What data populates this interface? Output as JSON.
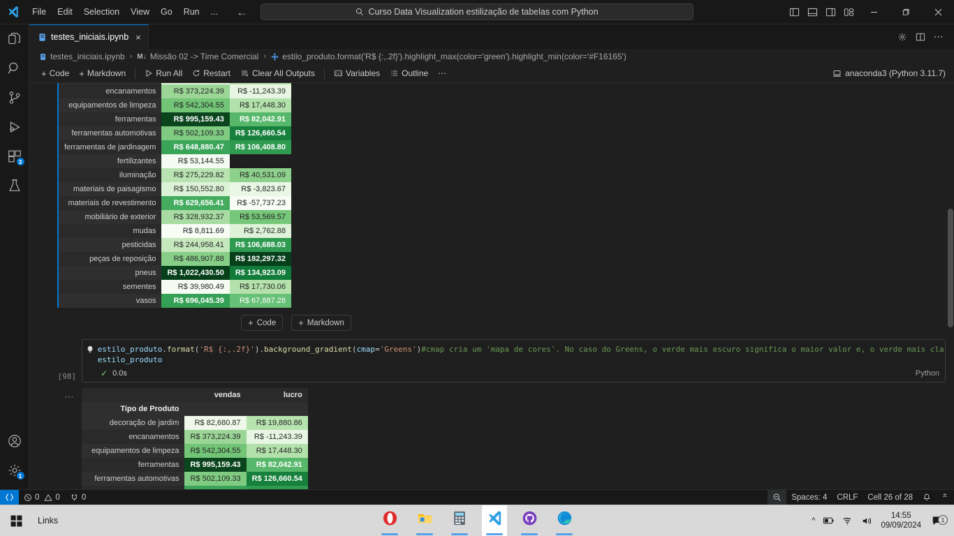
{
  "titlebar": {
    "menu": [
      "File",
      "Edit",
      "Selection",
      "View",
      "Go",
      "Run",
      "..."
    ],
    "search_text": "Curso Data Visualization estilização de tabelas com Python",
    "back_icon": "arrow-left-icon",
    "forward_icon": "arrow-right-icon"
  },
  "activitybar": {
    "items": [
      {
        "name": "explorer",
        "icon": "files-icon",
        "badge": ""
      },
      {
        "name": "search",
        "icon": "search-icon",
        "badge": ""
      },
      {
        "name": "source-control",
        "icon": "source-control-icon",
        "badge": ""
      },
      {
        "name": "run-and-debug",
        "icon": "run-debug-icon",
        "badge": ""
      },
      {
        "name": "extensions",
        "icon": "extensions-icon",
        "badge": "3"
      },
      {
        "name": "testing",
        "icon": "beaker-icon",
        "badge": ""
      }
    ],
    "bottom": [
      {
        "name": "accounts",
        "icon": "account-icon",
        "badge": ""
      },
      {
        "name": "manage",
        "icon": "gear-icon",
        "badge": "1"
      }
    ]
  },
  "tab": {
    "label": "testes_iniciais.ipynb",
    "close": "×"
  },
  "breadcrumbs": {
    "file": "testes_iniciais.ipynb",
    "section": "Missão 02 -> Time Comercial",
    "cell": "estilo_produto.format('R$ {:,.2f}').highlight_max(color='green').highlight_min(color='#F16165')",
    "md_badge": "M↓"
  },
  "notebook_toolbar": {
    "code": "Code",
    "markdown": "Markdown",
    "run_all": "Run All",
    "restart": "Restart",
    "clear_all_outputs": "Clear All Outputs",
    "variables": "Variables",
    "outline": "Outline",
    "more": "⋯",
    "kernel": "anaconda3 (Python 3.11.7)"
  },
  "add_cell": {
    "code": "Code",
    "markdown": "Markdown"
  },
  "code_cell": {
    "execution_count": "[98]",
    "duration": "0.0s",
    "language": "Python",
    "line1": {
      "var": "estilo_produto",
      "dot1": ".",
      "fn1": "format",
      "open1": "(",
      "str1": "'R$ {:,.2f}'",
      "close1": ")",
      "dot2": ".",
      "fn2": "background_gradient",
      "open2": "(",
      "param": "cmap",
      "eq": "=",
      "str2": "'Greens'",
      "close2": ")",
      "comment": "#cmap cria um 'mapa de cores'. No caso do Greens, o verde mais escuro significa o maior valor e, o verde mais claro (branco), significa o menor valor"
    },
    "line2": "estilo_produto"
  },
  "tables": {
    "columns": [
      "vendas",
      "lucro"
    ],
    "index_name": "Tipo de Produto",
    "rows": [
      {
        "label": "decoração de jardim",
        "vendas": "R$ 82,680.87",
        "lucro": "R$ 19,880.86",
        "vendas_bg": "#eff8ea",
        "lucro_bg": "#b7e3ae",
        "vendas_fg": "#262626",
        "lucro_fg": "#262626",
        "vendas_bold": false,
        "lucro_bold": false
      },
      {
        "label": "encanamentos",
        "vendas": "R$ 373,224.39",
        "lucro": "R$ -11,243.39",
        "vendas_bg": "#9bd696",
        "lucro_bg": "#e7f6e2",
        "vendas_fg": "#262626",
        "lucro_fg": "#262626",
        "vendas_bold": false,
        "lucro_bold": false
      },
      {
        "label": "equipamentos de limpeza",
        "vendas": "R$ 542,304.55",
        "lucro": "R$ 17,448.30",
        "vendas_bg": "#72c476",
        "lucro_bg": "#b3e1ab",
        "vendas_fg": "#262626",
        "lucro_fg": "#262626",
        "vendas_bold": false,
        "lucro_bold": false
      },
      {
        "label": "ferramentas",
        "vendas": "R$ 995,159.43",
        "lucro": "R$ 82,042.91",
        "vendas_bg": "#0a451d",
        "lucro_bg": "#57b76b",
        "vendas_fg": "#ffffff",
        "lucro_fg": "#ffffff",
        "vendas_bold": true,
        "lucro_bold": true
      },
      {
        "label": "ferramentas automotivas",
        "vendas": "R$ 502,109.33",
        "lucro": "R$ 126,660.54",
        "vendas_bg": "#7fcb81",
        "lucro_bg": "#16803c",
        "vendas_fg": "#262626",
        "lucro_fg": "#ffffff",
        "vendas_bold": false,
        "lucro_bold": true
      },
      {
        "label": "ferramentas de jardinagem",
        "vendas": "R$ 648,880.47",
        "lucro": "R$ 106,408.80",
        "vendas_bg": "#3aa458",
        "lucro_bg": "#2e9b51",
        "vendas_fg": "#ffffff",
        "lucro_fg": "#ffffff",
        "vendas_bold": true,
        "lucro_bold": true
      },
      {
        "label": "fertilizantes",
        "vendas": "R$ 53,144.55",
        "lucro": "R$ 22,509.86",
        "vendas_bg": "#f4fbf2",
        "lucro_bg": "#aede a6",
        "vendas_fg": "#262626",
        "lucro_fg": "#262626",
        "vendas_bold": false,
        "lucro_bold": false
      },
      {
        "label": "iluminação",
        "vendas": "R$ 275,229.82",
        "lucro": "R$ 40,531.09",
        "vendas_bg": "#b9e4b2",
        "lucro_bg": "#8ed18c",
        "vendas_fg": "#262626",
        "lucro_fg": "#262626",
        "vendas_bold": false,
        "lucro_bold": false
      },
      {
        "label": "materiais de paisagismo",
        "vendas": "R$ 150,552.80",
        "lucro": "R$ -3,823.67",
        "vendas_bg": "#dcf2d6",
        "lucro_bg": "#e9f7e4",
        "vendas_fg": "#262626",
        "lucro_fg": "#262626",
        "vendas_bold": false,
        "lucro_bold": false
      },
      {
        "label": "materiais de revestimento",
        "vendas": "R$ 629,656.41",
        "lucro": "R$ -57,737.23",
        "vendas_bg": "#44ab5f",
        "lucro_bg": "#f7fcf5",
        "vendas_fg": "#ffffff",
        "lucro_fg": "#262626",
        "vendas_bold": true,
        "lucro_bold": false
      },
      {
        "label": "mobiliário de exterior",
        "vendas": "R$ 328,932.37",
        "lucro": "R$ 53,569.57",
        "vendas_bg": "#a8dca2",
        "lucro_bg": "#76c77a",
        "vendas_fg": "#262626",
        "lucro_fg": "#262626",
        "vendas_bold": false,
        "lucro_bold": false
      },
      {
        "label": "mudas",
        "vendas": "R$ 8,811.69",
        "lucro": "R$ 2,762.88",
        "vendas_bg": "#f7fcf5",
        "lucro_bg": "#ddf2d7",
        "vendas_fg": "#262626",
        "lucro_fg": "#262626",
        "vendas_bold": false,
        "lucro_bold": false
      },
      {
        "label": "pesticidas",
        "vendas": "R$ 244,958.41",
        "lucro": "R$ 106,688.03",
        "vendas_bg": "#c5e8bd",
        "lucro_bg": "#2e9b51",
        "vendas_fg": "#262626",
        "lucro_fg": "#ffffff",
        "vendas_bold": false,
        "lucro_bold": true
      },
      {
        "label": "peças de reposição",
        "vendas": "R$ 486,907.88",
        "lucro": "R$ 182,297.32",
        "vendas_bg": "#87cf88",
        "lucro_bg": "#06401a",
        "vendas_fg": "#262626",
        "lucro_fg": "#ffffff",
        "vendas_bold": false,
        "lucro_bold": true
      },
      {
        "label": "pneus",
        "vendas": "R$ 1,022,430.50",
        "lucro": "R$ 134,923.09",
        "vendas_bg": "#06401a",
        "lucro_bg": "#117b39",
        "vendas_fg": "#ffffff",
        "lucro_fg": "#ffffff",
        "vendas_bold": true,
        "lucro_bold": true
      },
      {
        "label": "sementes",
        "vendas": "R$ 39,980.49",
        "lucro": "R$ 17,730.06",
        "vendas_bg": "#f6fcf4",
        "lucro_bg": "#b4e1ac",
        "vendas_fg": "#262626",
        "lucro_fg": "#262626",
        "vendas_bold": false,
        "lucro_bold": false
      },
      {
        "label": "vasos",
        "vendas": "R$ 696,045.39",
        "lucro": "R$ 67,887.28",
        "vendas_bg": "#35a156",
        "lucro_bg": "#66c076",
        "vendas_fg": "#ffffff",
        "lucro_fg": "#ffffff",
        "vendas_bold": true,
        "lucro_bold": false
      }
    ]
  },
  "statusbar": {
    "remote_icon": "remote-icon",
    "errors": "0",
    "warnings": "0",
    "ports": "0",
    "spaces": "Spaces: 4",
    "eol": "CRLF",
    "cell": "Cell 26 of 28",
    "bell_icon": "bell-icon",
    "zoom_icon": "screencast-icon"
  },
  "taskbar": {
    "links": "Links",
    "apps": [
      "opera-icon",
      "file-explorer-icon",
      "calculator-icon",
      "vscode-icon",
      "github-desktop-icon",
      "edge-icon"
    ],
    "time": "14:55",
    "date": "09/09/2024",
    "notification_count": "1"
  }
}
